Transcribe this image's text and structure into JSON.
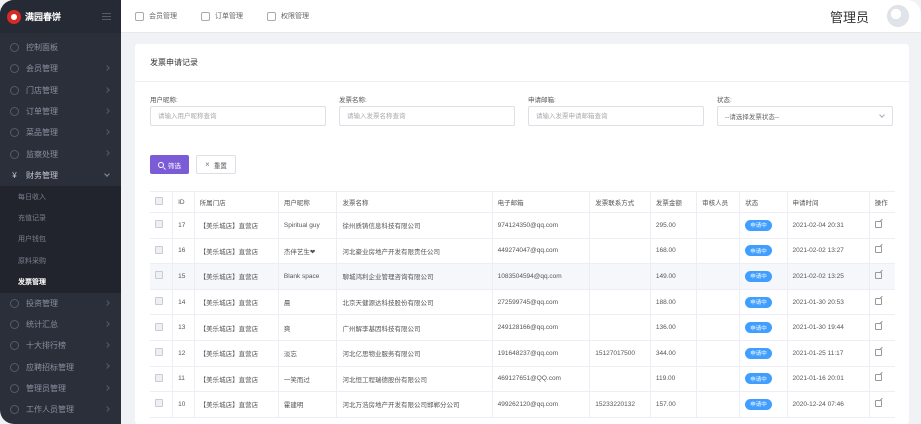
{
  "brand": {
    "name": "满园春饼"
  },
  "sidebar": {
    "items": [
      {
        "label": "控制面板"
      },
      {
        "label": "会员管理"
      },
      {
        "label": "门店管理"
      },
      {
        "label": "订单管理"
      },
      {
        "label": "菜品管理"
      },
      {
        "label": "监察处理"
      },
      {
        "label": "财务管理"
      },
      {
        "label": "每日收入"
      },
      {
        "label": "充值记录"
      },
      {
        "label": "用户钱包"
      },
      {
        "label": "原料采购"
      },
      {
        "label": "发票管理"
      },
      {
        "label": "投资管理"
      },
      {
        "label": "统计汇总"
      },
      {
        "label": "十大排行榜"
      },
      {
        "label": "应聘招标管理"
      },
      {
        "label": "管理员管理"
      },
      {
        "label": "工作人员管理"
      }
    ],
    "finance_icon": "¥"
  },
  "header": {
    "tabs": [
      {
        "label": "会员管理"
      },
      {
        "label": "订单管理"
      },
      {
        "label": "权限管理"
      }
    ],
    "admin_label": "管理员"
  },
  "panel": {
    "title": "发票申请记录"
  },
  "filters": {
    "user_nick": {
      "label": "用户昵称:",
      "placeholder": "请输入用户昵称查询"
    },
    "invoice_name": {
      "label": "发票名称:",
      "placeholder": "请输入发票名称查询"
    },
    "email": {
      "label": "申请邮箱:",
      "placeholder": "请输入发票申请邮箱查询"
    },
    "status": {
      "label": "状态:",
      "value": "--请选择发票状态--"
    }
  },
  "buttons": {
    "search": "筛选",
    "reset": "重置",
    "reset_icon": "×"
  },
  "table": {
    "headers": [
      "",
      "ID",
      "所属门店",
      "用户昵称",
      "发票名称",
      "电子邮箱",
      "发票联系方式",
      "发票金额",
      "审核人员",
      "状态",
      "申请时间",
      "操作"
    ],
    "rows": [
      {
        "id": "17",
        "store": "【美乐城店】直营店",
        "nick": "Spiritual guy",
        "invoice": "徐州质铸信息科技有限公司",
        "email": "974124350@qq.com",
        "phone": "",
        "amount": "295.00",
        "auditor": "",
        "status": "申请中",
        "time": "2021-02-04 20:31"
      },
      {
        "id": "16",
        "store": "【美乐城店】直营店",
        "nick": "杰伴艺生❤",
        "invoice": "河北豪业房地产开发有限责任公司",
        "email": "449274047@qq.com",
        "phone": "",
        "amount": "168.00",
        "auditor": "",
        "status": "申请中",
        "time": "2021-02-02 13:27"
      },
      {
        "id": "15",
        "store": "【美乐城店】直营店",
        "nick": "Blank space",
        "invoice": "聊城鸿利企业管理咨询有限公司",
        "email": "1083504594@qq.com",
        "phone": "",
        "amount": "149.00",
        "auditor": "",
        "status": "申请中",
        "time": "2021-02-02 13:25"
      },
      {
        "id": "14",
        "store": "【美乐城店】直营店",
        "nick": "晨",
        "invoice": "北京天健源达科技股份有限公司",
        "email": "272599745@qq.com",
        "phone": "",
        "amount": "188.00",
        "auditor": "",
        "status": "申请中",
        "time": "2021-01-30 20:53"
      },
      {
        "id": "13",
        "store": "【美乐城店】直营店",
        "nick": "爽",
        "invoice": "广州解李基因科技有限公司",
        "email": "249128166@qq.com",
        "phone": "",
        "amount": "136.00",
        "auditor": "",
        "status": "申请中",
        "time": "2021-01-30 19:44"
      },
      {
        "id": "12",
        "store": "【美乐城店】直营店",
        "nick": "淡忘",
        "invoice": "河北亿思物业服务有限公司",
        "email": "191648237@qq.com",
        "phone": "15127017500",
        "amount": "344.00",
        "auditor": "",
        "status": "申请中",
        "time": "2021-01-25 11:17"
      },
      {
        "id": "11",
        "store": "【美乐城店】直营店",
        "nick": "一笑而过",
        "invoice": "河北恒工程瑞德股份有限公司",
        "email": "469127651@QQ.com",
        "phone": "",
        "amount": "119.00",
        "auditor": "",
        "status": "申请中",
        "time": "2021-01-16 20:01"
      },
      {
        "id": "10",
        "store": "【美乐城店】直营店",
        "nick": "霍建明",
        "invoice": "河北万浩房地产开发有限公司邯郸分公司",
        "email": "499262120@qq.com",
        "phone": "15233220132",
        "amount": "157.00",
        "auditor": "",
        "status": "申请中",
        "time": "2020-12-24 07:46"
      }
    ]
  },
  "colors": {
    "accent": "#7c5cd6",
    "badge": "#409eff",
    "sidebar": "#2b2f3a",
    "brand_red": "#d62b25"
  }
}
